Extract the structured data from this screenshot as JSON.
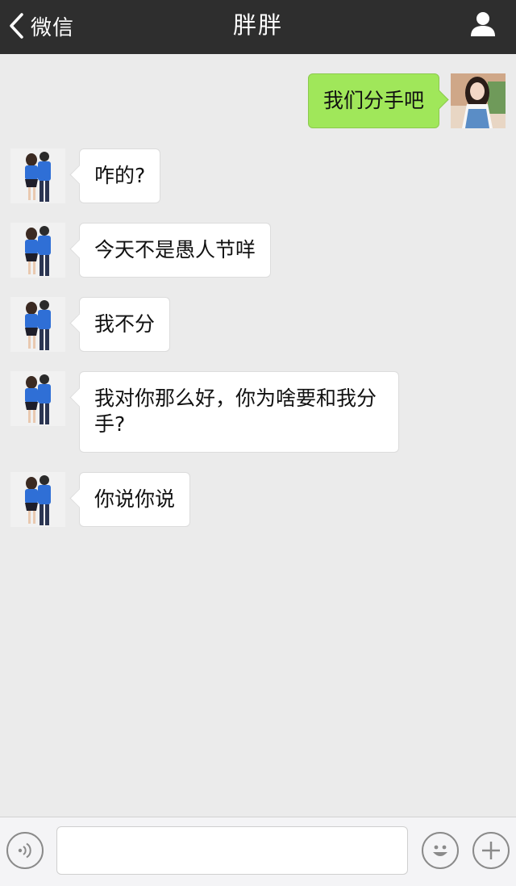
{
  "navbar": {
    "back_label": "微信",
    "title": "胖胖",
    "back_icon": "chevron-left-icon",
    "profile_icon": "person-icon"
  },
  "messages": [
    {
      "side": "out",
      "text": "我们分手吧"
    },
    {
      "side": "in",
      "text": "咋的?"
    },
    {
      "side": "in",
      "text": "今天不是愚人节咩"
    },
    {
      "side": "in",
      "text": "我不分"
    },
    {
      "side": "in",
      "text": "我对你那么好，你为啥要和我分手?"
    },
    {
      "side": "in",
      "text": "你说你说"
    }
  ],
  "input_bar": {
    "voice_icon": "voice-icon",
    "emoji_icon": "emoji-icon",
    "plus_icon": "plus-icon",
    "input_value": ""
  },
  "colors": {
    "navbar_bg": "#2e2e2e",
    "chat_bg": "#ebebeb",
    "outgoing_bubble": "#a0e75a",
    "incoming_bubble": "#ffffff"
  }
}
